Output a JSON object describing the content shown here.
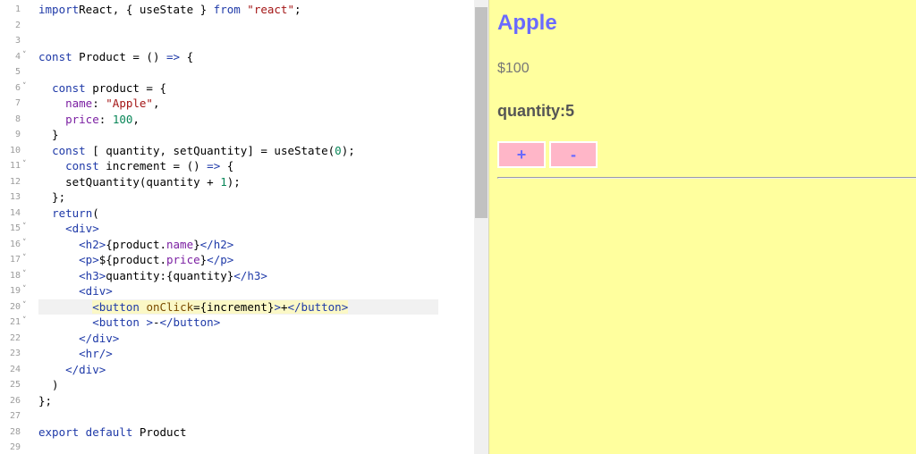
{
  "editor": {
    "lines": [
      {
        "n": "1",
        "fold": false,
        "parts": [
          [
            "kw",
            "import"
          ],
          [
            "",
            "React, { useState } "
          ],
          [
            "kw",
            "from"
          ],
          [
            "",
            ""
          ],
          [
            "str",
            " \"react\""
          ],
          [
            "",
            ";"
          ]
        ]
      },
      {
        "n": "2",
        "fold": false,
        "parts": []
      },
      {
        "n": "3",
        "fold": false,
        "parts": []
      },
      {
        "n": "4",
        "fold": true,
        "parts": [
          [
            "kw",
            "const"
          ],
          [
            "",
            " Product = () "
          ],
          [
            "kw",
            "=>"
          ],
          [
            "",
            " {"
          ]
        ]
      },
      {
        "n": "5",
        "fold": false,
        "parts": []
      },
      {
        "n": "6",
        "fold": true,
        "parts": [
          [
            "",
            "  "
          ],
          [
            "kw",
            "const"
          ],
          [
            "",
            " product = {"
          ]
        ]
      },
      {
        "n": "7",
        "fold": false,
        "parts": [
          [
            "",
            "    "
          ],
          [
            "prop",
            "name"
          ],
          [
            "",
            ": "
          ],
          [
            "str",
            "\"Apple\""
          ],
          [
            "",
            ","
          ]
        ]
      },
      {
        "n": "8",
        "fold": false,
        "parts": [
          [
            "",
            "    "
          ],
          [
            "prop",
            "price"
          ],
          [
            "",
            ": "
          ],
          [
            "num",
            "100"
          ],
          [
            "",
            ","
          ]
        ]
      },
      {
        "n": "9",
        "fold": false,
        "parts": [
          [
            "",
            "  }"
          ]
        ]
      },
      {
        "n": "10",
        "fold": false,
        "parts": [
          [
            "",
            "  "
          ],
          [
            "kw",
            "const"
          ],
          [
            "",
            " [ quantity, setQuantity] = useState("
          ],
          [
            "num",
            "0"
          ],
          [
            "",
            ");"
          ]
        ]
      },
      {
        "n": "11",
        "fold": true,
        "parts": [
          [
            "",
            "    "
          ],
          [
            "kw",
            "const"
          ],
          [
            "",
            " increment = () "
          ],
          [
            "kw",
            "=>"
          ],
          [
            "",
            " {"
          ]
        ]
      },
      {
        "n": "12",
        "fold": false,
        "parts": [
          [
            "",
            "    setQuantity(quantity + "
          ],
          [
            "num",
            "1"
          ],
          [
            "",
            ");"
          ]
        ]
      },
      {
        "n": "13",
        "fold": false,
        "parts": [
          [
            "",
            "  };"
          ]
        ]
      },
      {
        "n": "14",
        "fold": false,
        "parts": [
          [
            "",
            "  "
          ],
          [
            "kw",
            "return"
          ],
          [
            "",
            "("
          ]
        ]
      },
      {
        "n": "15",
        "fold": true,
        "parts": [
          [
            "",
            "    "
          ],
          [
            "tag",
            "<div>"
          ]
        ]
      },
      {
        "n": "16",
        "fold": true,
        "parts": [
          [
            "",
            "      "
          ],
          [
            "tag",
            "<h2>"
          ],
          [
            "",
            "{product."
          ],
          [
            "prop",
            "name"
          ],
          [
            "",
            "}"
          ],
          [
            "tag",
            "</h2>"
          ]
        ]
      },
      {
        "n": "17",
        "fold": true,
        "parts": [
          [
            "",
            "      "
          ],
          [
            "tag",
            "<p>"
          ],
          [
            "",
            "${product."
          ],
          [
            "prop",
            "price"
          ],
          [
            "",
            "}"
          ],
          [
            "tag",
            "</p>"
          ]
        ]
      },
      {
        "n": "18",
        "fold": true,
        "parts": [
          [
            "",
            "      "
          ],
          [
            "tag",
            "<h3>"
          ],
          [
            "",
            "quantity:{quantity}"
          ],
          [
            "tag",
            "</h3>"
          ]
        ]
      },
      {
        "n": "19",
        "fold": true,
        "parts": [
          [
            "",
            "      "
          ],
          [
            "tag",
            "<div>"
          ]
        ]
      },
      {
        "n": "20",
        "fold": true,
        "active": true,
        "parts": [
          [
            "",
            "        "
          ],
          [
            "tag hl",
            "<button"
          ],
          [
            "hl",
            " "
          ],
          [
            "attr hl",
            "onClick"
          ],
          [
            "hl",
            "={increment}"
          ],
          [
            "tag hl",
            ">"
          ],
          [
            "hl",
            "+"
          ],
          [
            "tag hl",
            "</button>"
          ]
        ]
      },
      {
        "n": "21",
        "fold": true,
        "parts": [
          [
            "",
            "        "
          ],
          [
            "tag",
            "<button "
          ],
          [
            "tag",
            ">"
          ],
          [
            "",
            "-"
          ],
          [
            "tag",
            "</button>"
          ]
        ]
      },
      {
        "n": "22",
        "fold": false,
        "parts": [
          [
            "",
            "      "
          ],
          [
            "tag",
            "</div>"
          ]
        ]
      },
      {
        "n": "23",
        "fold": false,
        "parts": [
          [
            "",
            "      "
          ],
          [
            "tag",
            "<hr/>"
          ]
        ]
      },
      {
        "n": "24",
        "fold": false,
        "parts": [
          [
            "",
            "    "
          ],
          [
            "tag",
            "</div>"
          ]
        ]
      },
      {
        "n": "25",
        "fold": false,
        "parts": [
          [
            "",
            "  )"
          ]
        ]
      },
      {
        "n": "26",
        "fold": false,
        "parts": [
          [
            "",
            "};"
          ]
        ]
      },
      {
        "n": "27",
        "fold": false,
        "parts": []
      },
      {
        "n": "28",
        "fold": false,
        "parts": [
          [
            "kw",
            "export"
          ],
          [
            "",
            ""
          ],
          [
            "kw",
            " default"
          ],
          [
            "",
            " Product"
          ]
        ]
      },
      {
        "n": "29",
        "fold": false,
        "parts": []
      }
    ]
  },
  "preview": {
    "product_name": "Apple",
    "price": "$100",
    "quantity": "quantity:5",
    "plus_label": "+",
    "minus_label": "-"
  },
  "colors": {
    "preview_bg": "#ffff9e",
    "accent": "#6a6aff",
    "button_bg": "#ffb6c8"
  }
}
